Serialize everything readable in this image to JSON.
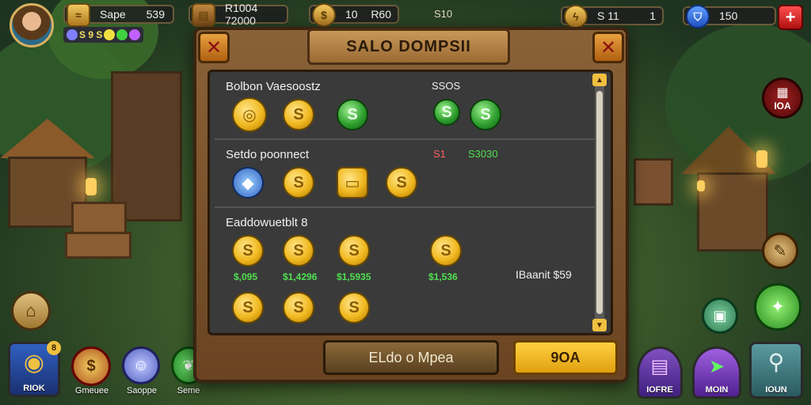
{
  "hud": {
    "name_value": "Sape",
    "name_count": "539",
    "chest_value": "R1004 72000",
    "coins_value": "10",
    "coins_extra": "R60",
    "gold_label": "S10",
    "energy_value": "S 11",
    "energy_extra": "1",
    "energy_count": "150",
    "gem_count": "S 9 S",
    "add_label": "+"
  },
  "dialog": {
    "title": "SALO DOMPSII",
    "sections": [
      {
        "title": "Bolbon Vaesoostz",
        "side_label": "SSOS",
        "items": [
          {
            "type": "pile",
            "icon": "coin-pile-icon"
          },
          {
            "type": "gold",
            "icon": "gold-coin-icon"
          },
          {
            "type": "green",
            "icon": "green-coin-icon"
          },
          {
            "type": "green",
            "icon": "green-coin-icon"
          },
          {
            "type": "green",
            "icon": "green-coin-icon"
          }
        ]
      },
      {
        "title": "Setdo poonnect",
        "side_label": "S1",
        "side_value": "S3030",
        "items": [
          {
            "type": "gem",
            "icon": "blue-gem-icon"
          },
          {
            "type": "gold",
            "icon": "gold-coin-icon"
          },
          {
            "type": "bill",
            "icon": "cash-icon"
          },
          {
            "type": "gold",
            "icon": "gold-coin-icon"
          }
        ]
      },
      {
        "title": "Eaddowuetblt 8",
        "prices": [
          "$,095",
          "$1,4296",
          "$1,5935",
          "$1,536"
        ],
        "side_text": "IBaanit $59",
        "items": [
          {
            "type": "gold",
            "icon": "gold-coin-icon"
          },
          {
            "type": "gold",
            "icon": "gold-coin-icon"
          },
          {
            "type": "gold",
            "icon": "gold-coin-icon"
          },
          {
            "type": "gold",
            "icon": "gold-coin-icon"
          },
          {
            "type": "gold",
            "icon": "gold-coin-icon"
          },
          {
            "type": "gold",
            "icon": "gold-coin-icon"
          },
          {
            "type": "gold",
            "icon": "gold-coin-icon"
          }
        ]
      }
    ],
    "coin_symbol": "S",
    "button_secondary": "ELdo o Mpea",
    "button_primary": "9OA"
  },
  "right_menu": {
    "top_button": "IOA",
    "store_label": "IOFRE",
    "moin_label": "MOIN",
    "loun_label": "IOUN"
  },
  "left_menu": {
    "riok_label": "RIOK",
    "riok_badge": "8",
    "label2": "Gmeuee",
    "label3": "Saoppe",
    "label4": "Seme"
  },
  "colors": {
    "accent_gold": "#f0c040",
    "price_green": "#50e050",
    "frame_brown": "#6a4422"
  }
}
